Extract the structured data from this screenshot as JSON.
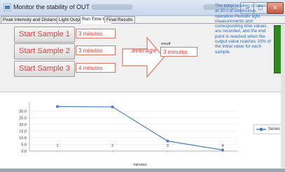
{
  "window": {
    "title": "Monitor the stability of OUT",
    "controls": {
      "minimize": "–",
      "maximize": "□",
      "close": "✕"
    }
  },
  "tabs": [
    "Peak Intensity and Distance",
    "Light Output",
    "Run Time test",
    "Final Results"
  ],
  "active_tab": "Run Time test",
  "samples": [
    {
      "label": "Start Sample 1",
      "value": "3 minutes"
    },
    {
      "label": "Start Sample 2",
      "value": "3 minutes"
    },
    {
      "label": "Start Sample 3",
      "value": "4 minutes"
    }
  ],
  "average_label": "average",
  "result": {
    "label": "result",
    "value": "3 minutes"
  },
  "info_text": "The initial reading is taken at 30 s of continuous operation Periodic light measurements and corresponding time values are recorded, and the end point is reached when the output value reaches 10% of the initial value for each sample.",
  "colors": {
    "accent": "#e0413d",
    "info": "#2a6cc6",
    "indicator": "#2c8a1f",
    "series": "#4a7ebb"
  },
  "chart_data": {
    "type": "line",
    "x": [
      1,
      2,
      3,
      4
    ],
    "series": [
      {
        "name": "Series 1",
        "values": [
          33.5,
          33.2,
          7.5,
          0.8
        ]
      }
    ],
    "xlabel": "minutes",
    "ylabel": "",
    "ylim": [
      0,
      30
    ],
    "yticks": [
      "0.0",
      "5.0",
      "10.0",
      "15.0",
      "20.0",
      "25.0",
      "30.0"
    ],
    "xticks": [
      "1",
      "2",
      "3",
      "4"
    ],
    "grid": true,
    "legend": "right"
  }
}
